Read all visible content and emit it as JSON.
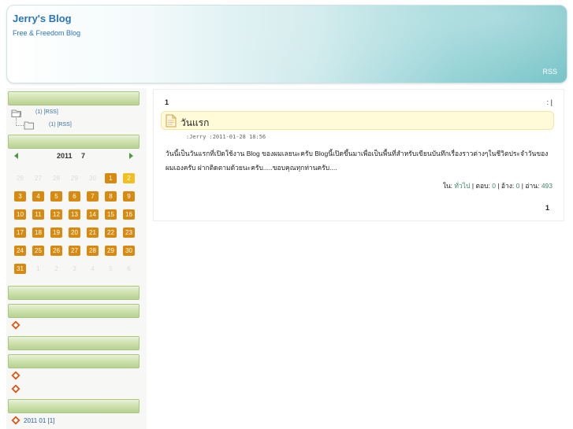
{
  "header": {
    "title": "Jerry's Blog",
    "subtitle": "Free & Freedom Blog",
    "rss": "RSS"
  },
  "sidebar": {
    "tree": [
      {
        "text": "(1) [RSS]"
      },
      {
        "text": "(1) [RSS]"
      }
    ],
    "calendar": {
      "year": "2011",
      "month": "7",
      "prev_icon": "left-arrow-icon",
      "next_icon": "right-arrow-icon",
      "leading_ghost": [
        "26",
        "27",
        "28",
        "29",
        "30"
      ],
      "days": [
        "1",
        "2",
        "3",
        "4",
        "5",
        "6",
        "7",
        "8",
        "9",
        "10",
        "11",
        "12",
        "13",
        "14",
        "15",
        "16",
        "17",
        "18",
        "19",
        "20",
        "21",
        "22",
        "23",
        "24",
        "25",
        "26",
        "27",
        "28",
        "29",
        "30",
        "31"
      ],
      "highlight_day": "2",
      "trailing_ghost": [
        "1",
        "2",
        "3",
        "4",
        "5",
        "6"
      ]
    },
    "archive": {
      "text": "2011 01 [1]"
    },
    "colors": {
      "bar": "#cfe2b0",
      "day": "#d88a10",
      "today": "#f0c020"
    }
  },
  "main": {
    "page_number_top": "1",
    "pager_right": ":  |",
    "post": {
      "title": "วันแรก",
      "meta": ":Jerry   :2011-01-28 18:56",
      "body": "วันนี้เป็นวันแรกที่เปิดใช้งาน Blog ของผมเลยนะครับ Blogนี้เปิดขึ้นมาเพื่อเป็นพื้นที่สำหรับเขียนบันทึกเรื่องราวต่างๆในชีวิตประจำวันของผมเองครับ ฝากติดตามด้วยนะครับ.....ขอบคุณทุกท่านครับ....",
      "footer": {
        "cat_label": "ใน:",
        "cat_value": "ทั่วไป",
        "comments_label": "ตอบ:",
        "comments_value": "0",
        "trackback_label": "อ้าง:",
        "trackback_value": "0",
        "views_label": "อ่าน:",
        "views_value": "493"
      }
    },
    "page_number_bottom": "1"
  }
}
